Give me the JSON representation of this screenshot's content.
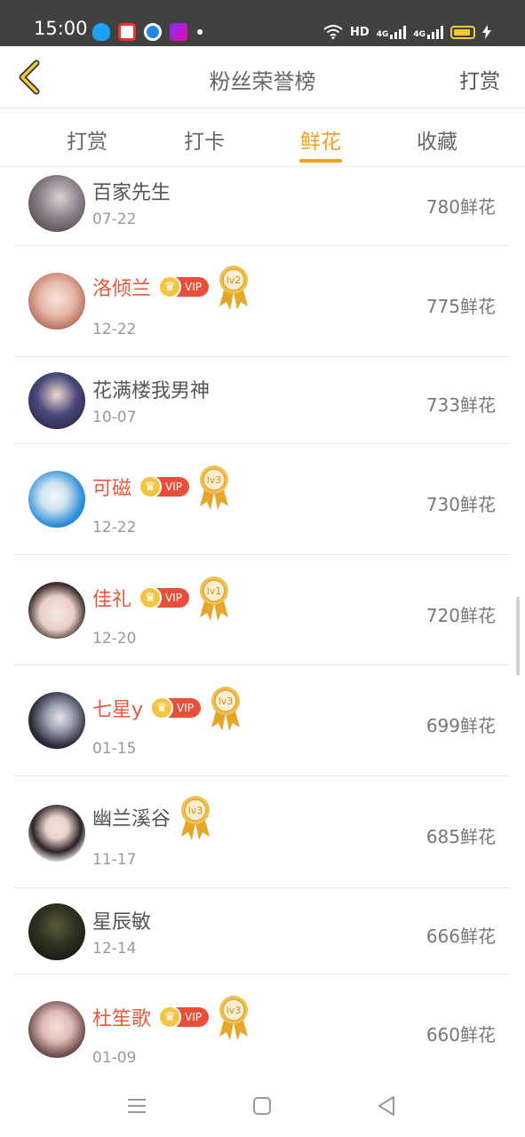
{
  "status": {
    "time": "15:00",
    "hd_label": "HD",
    "net1": "4G",
    "net2": "4G"
  },
  "header": {
    "title": "粉丝荣誉榜",
    "right_action": "打赏",
    "back_icon": "chevron-left-icon"
  },
  "tabs": [
    {
      "label": "打赏",
      "active": false
    },
    {
      "label": "打卡",
      "active": false
    },
    {
      "label": "鲜花",
      "active": true
    },
    {
      "label": "收藏",
      "active": false
    }
  ],
  "colors": {
    "accent": "#f0a020",
    "vip_name": "#e55a3a",
    "vip_badge": "#e94e3b"
  },
  "rows": [
    {
      "name": "百家先生",
      "date": "07-22",
      "count": "780鲜花",
      "vip": false,
      "level": ""
    },
    {
      "name": "洛倾兰",
      "date": "12-22",
      "count": "775鲜花",
      "vip": true,
      "vip_label": "VIP",
      "level": "lv2"
    },
    {
      "name": "花满楼我男神",
      "date": "10-07",
      "count": "733鲜花",
      "vip": false,
      "level": ""
    },
    {
      "name": "可磁",
      "date": "12-22",
      "count": "730鲜花",
      "vip": true,
      "vip_label": "VIP",
      "level": "lv3"
    },
    {
      "name": "佳礼",
      "date": "12-20",
      "count": "720鲜花",
      "vip": true,
      "vip_label": "VIP",
      "level": "lv1"
    },
    {
      "name": "七星y",
      "date": "01-15",
      "count": "699鲜花",
      "vip": true,
      "vip_label": "VIP",
      "level": "lv3"
    },
    {
      "name": "幽兰溪谷",
      "date": "11-17",
      "count": "685鲜花",
      "vip": false,
      "level": "lv3"
    },
    {
      "name": "星辰敏",
      "date": "12-14",
      "count": "666鲜花",
      "vip": false,
      "level": ""
    },
    {
      "name": "杜笙歌",
      "date": "01-09",
      "count": "660鲜花",
      "vip": true,
      "vip_label": "VIP",
      "level": "lv3"
    }
  ]
}
